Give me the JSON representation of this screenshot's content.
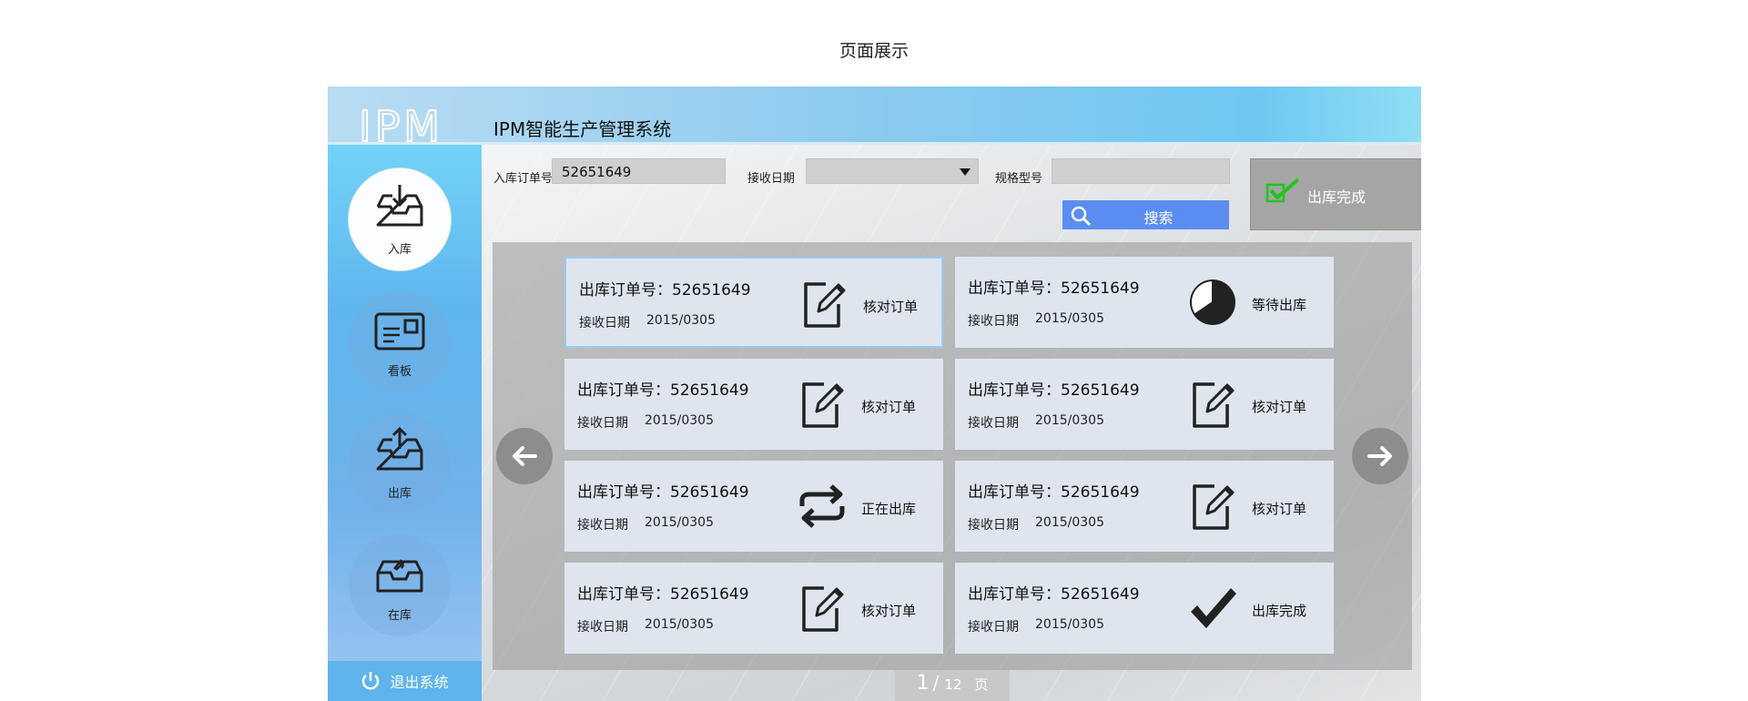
{
  "page": {
    "title": "页面展示"
  },
  "app": {
    "title": "IPM智能生产管理系统",
    "logo_text": "IPM"
  },
  "sidebar": {
    "items": [
      {
        "label": "入库",
        "icon": "inbox-download-icon",
        "active": true
      },
      {
        "label": "看板",
        "icon": "board-icon",
        "active": false
      },
      {
        "label": "出库",
        "icon": "inbox-upload-icon",
        "active": false
      },
      {
        "label": "在库",
        "icon": "inbox-stock-icon",
        "active": false
      }
    ],
    "logout_label": "退出系统"
  },
  "filters": {
    "order_label": "入库订单号",
    "order_value": "52651649",
    "date_label": "接收日期",
    "date_value": "",
    "spec_label": "规格型号",
    "spec_value": "",
    "search_label": "搜索",
    "status_button_label": "出库完成"
  },
  "cards": [
    {
      "order": "出库订单号：52651649",
      "date_label": "接收日期",
      "date": "2015/0305",
      "status": "核对订单",
      "icon": "edit-document-icon"
    },
    {
      "order": "出库订单号：52651649",
      "date_label": "接收日期",
      "date": "2015/0305",
      "status": "等待出库",
      "icon": "clock-icon"
    },
    {
      "order": "出库订单号：52651649",
      "date_label": "接收日期",
      "date": "2015/0305",
      "status": "核对订单",
      "icon": "edit-document-icon"
    },
    {
      "order": "出库订单号：52651649",
      "date_label": "接收日期",
      "date": "2015/0305",
      "status": "核对订单",
      "icon": "edit-document-icon"
    },
    {
      "order": "出库订单号：52651649",
      "date_label": "接收日期",
      "date": "2015/0305",
      "status": "正在出库",
      "icon": "repeat-icon"
    },
    {
      "order": "出库订单号：52651649",
      "date_label": "接收日期",
      "date": "2015/0305",
      "status": "核对订单",
      "icon": "edit-document-icon"
    },
    {
      "order": "出库订单号：52651649",
      "date_label": "接收日期",
      "date": "2015/0305",
      "status": "核对订单",
      "icon": "edit-document-icon"
    },
    {
      "order": "出库订单号：52651649",
      "date_label": "接收日期",
      "date": "2015/0305",
      "status": "出库完成",
      "icon": "checkmark-icon"
    }
  ],
  "pagination": {
    "current": "1",
    "separator": "/",
    "total": "12",
    "unit": "页"
  },
  "colors": {
    "accent": "#5b8df0",
    "sidebar": "#5fb4ec",
    "success": "#22c41e",
    "card": "#dfe5ef"
  }
}
